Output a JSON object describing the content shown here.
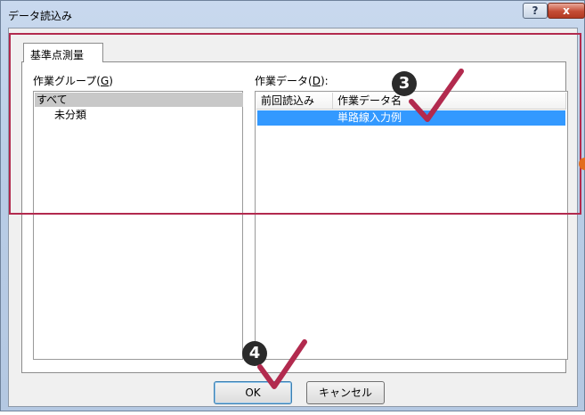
{
  "window": {
    "title": "データ読込み",
    "help_label": "?",
    "close_label": "x"
  },
  "tab": {
    "label": "基準点測量"
  },
  "group": {
    "label": "作業グループ(",
    "mnemonic": "G",
    "label_end": ")",
    "items": [
      {
        "label": "すべて",
        "selected": true
      },
      {
        "label": "未分類",
        "selected": false
      }
    ]
  },
  "data": {
    "label": "作業データ(",
    "mnemonic": "D",
    "label_end": "):",
    "columns": [
      "前回読込み",
      "作業データ名"
    ],
    "rows": [
      {
        "last_loaded": "",
        "name": "単路線入力例",
        "selected": true
      }
    ]
  },
  "buttons": {
    "ok": "OK",
    "cancel": "キャンセル"
  },
  "annotations": {
    "step3": "3",
    "step4": "4",
    "highlight_color": "#b22a4e",
    "check_color": "#b22a4e",
    "dot_color": "#e36c1e"
  }
}
